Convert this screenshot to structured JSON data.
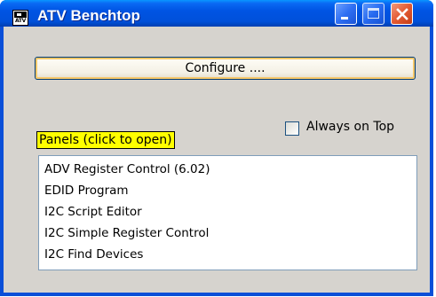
{
  "window": {
    "title": "ATV Benchtop",
    "icon": "atv-app-icon",
    "icon_text": "ATV",
    "controls": [
      "minimize-icon",
      "maximize-icon",
      "close-icon"
    ]
  },
  "configure_button": {
    "label": "Configure ...."
  },
  "always_on_top": {
    "label": "Always on Top",
    "checked": false
  },
  "panels": {
    "label": "Panels (click to open)",
    "items": [
      "ADV Register Control (6.02)",
      "EDID Program",
      "I2C Script Editor",
      "I2C Simple Register Control",
      "I2C Find Devices"
    ]
  },
  "colors": {
    "titlebar": "#0054e3",
    "panels_label_bg": "#ffff00",
    "client_bg": "#d6d3ce"
  }
}
